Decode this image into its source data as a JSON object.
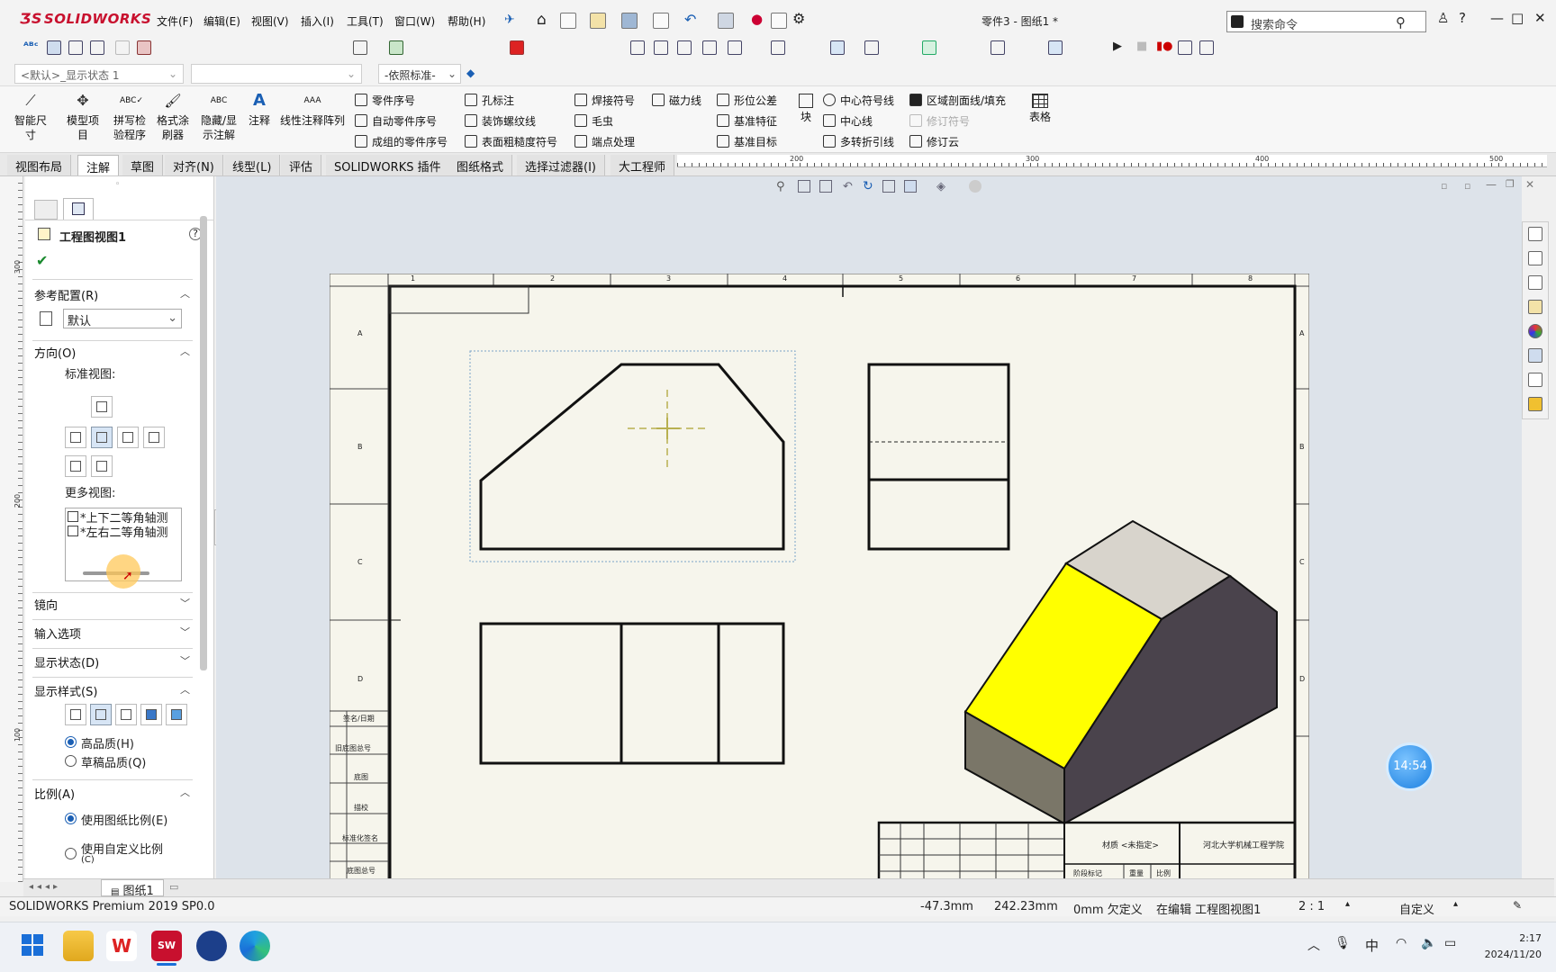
{
  "app": {
    "logo": "SOLIDWORKS",
    "document_title": "零件3 - 图纸1 *",
    "menu": [
      "文件(F)",
      "编辑(E)",
      "视图(V)",
      "插入(I)",
      "工具(T)",
      "窗口(W)",
      "帮助(H)"
    ],
    "search_placeholder": "搜索命令"
  },
  "config": {
    "display_state": "<默认>_显示状态 1",
    "standard": "-依照标准-"
  },
  "ribbon": {
    "big": [
      "智能尺寸",
      "模型项目",
      "拼写检验程序",
      "格式涂刷器",
      "隐藏/显示注解",
      "注释",
      "线性注释阵列",
      "块",
      "表格"
    ],
    "col1": [
      "零件序号",
      "自动零件序号",
      "成组的零件序号"
    ],
    "col2": [
      "孔标注",
      "装饰螺纹线",
      "表面粗糙度符号"
    ],
    "col3": [
      "焊接符号",
      "毛虫",
      "端点处理"
    ],
    "col4": [
      "磁力线"
    ],
    "col5": [
      "形位公差",
      "基准特征",
      "基准目标"
    ],
    "col6": [
      "中心符号线",
      "中心线",
      "多转折引线"
    ],
    "col7": [
      "区域剖面线/填充",
      "修订符号",
      "修订云"
    ]
  },
  "tabs": [
    "视图布局",
    "注解",
    "草图",
    "对齐(N)",
    "线型(L)",
    "评估",
    "SOLIDWORKS 插件",
    "图纸格式",
    "选择过滤器(I)",
    "大工程师"
  ],
  "active_tab": "注解",
  "ruler": [
    "200",
    "300",
    "400",
    "500"
  ],
  "vruler": [
    "300",
    "200",
    "100"
  ],
  "property_manager": {
    "title": "工程图视图1",
    "ref_config_label": "参考配置(R)",
    "ref_config_value": "默认",
    "orientation_label": "方向(O)",
    "standard_views_label": "标准视图:",
    "more_views_label": "更多视图:",
    "more_views": [
      "*上下二等角轴测",
      "*左右二等角轴测"
    ],
    "mirror_label": "镜向",
    "import_label": "输入选项",
    "display_state_label": "显示状态(D)",
    "display_style_label": "显示样式(S)",
    "quality_hq": "高品质(H)",
    "quality_draft": "草稿品质(Q)",
    "scale_label": "比例(A)",
    "scale_sheet": "使用图纸比例(E)",
    "scale_custom": "使用自定义比例",
    "scale_custom_key": "(C)"
  },
  "drawing": {
    "col_nums": [
      "1",
      "2",
      "3",
      "4",
      "5",
      "6",
      "7",
      "8"
    ],
    "row_letters": [
      "A",
      "B",
      "C",
      "D"
    ],
    "left_labels": [
      "签名/日期",
      "旧底图总号",
      "底图",
      "描校",
      "标准化签名",
      "底图总号"
    ],
    "tb_material": "材质 <未指定>",
    "tb_school": "河北大学机械工程学院",
    "tb_row": "阶段标记",
    "tb_weight": "重量",
    "tb_scale": "比例"
  },
  "time_badge": "14:54",
  "sheet_tab": "图纸1",
  "status": {
    "product": "SOLIDWORKS Premium 2019 SP0.0",
    "x": "-47.3mm",
    "y": "242.23mm",
    "z": "0mm 欠定义",
    "editing": "在编辑 工程图视图1",
    "scale": "2 : 1",
    "units": "自定义"
  },
  "taskbar": {
    "time": "2:17",
    "date": "2024/11/20",
    "ime": "中"
  },
  "colors": {
    "face_yellow": "#ffff00",
    "face_top": "#d8d4cc",
    "face_dark": "#4a434c",
    "face_left": "#7a7668",
    "sheet": "#f6f5ec"
  }
}
